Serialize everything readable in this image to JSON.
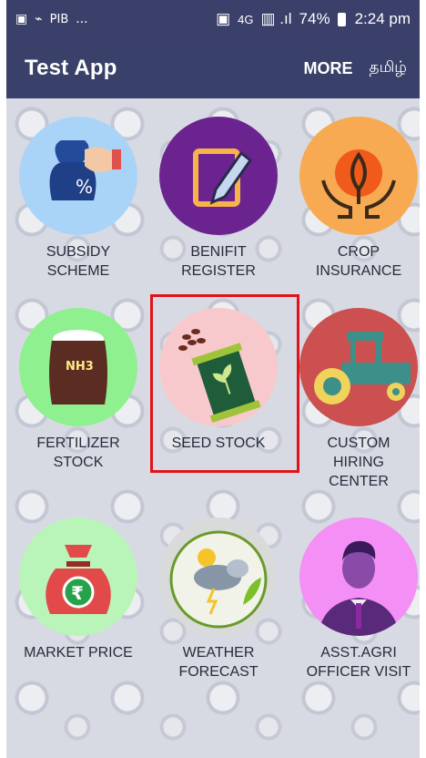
{
  "status_bar": {
    "left_icons": [
      "image-icon",
      "cast-icon"
    ],
    "pib_text": "PIB",
    "dots": "...",
    "network": "4G",
    "battery": "74%",
    "time": "2:24 pm"
  },
  "app_bar": {
    "title": "Test App",
    "more_label": "MORE",
    "language_label": "தமிழ்"
  },
  "tiles": [
    {
      "line1": "SUBSIDY",
      "line2": "SCHEME",
      "icon": "money-bag-hand-icon",
      "color": "#a9d4f8"
    },
    {
      "line1": "BENIFIT",
      "line2": "REGISTER",
      "icon": "pencil-document-icon",
      "color": "#6b2390"
    },
    {
      "line1": "CROP",
      "line2": "INSURANCE",
      "icon": "hands-plant-icon",
      "color": "#f8aa52"
    },
    {
      "line1": "FERTILIZER",
      "line2": "STOCK",
      "icon": "fertilizer-sack-icon",
      "color": "#8ff08f"
    },
    {
      "line1": "SEED STOCK",
      "line2": "",
      "icon": "seed-packet-icon",
      "color": "#f8c9cc"
    },
    {
      "line1": "CUSTOM",
      "line2": "HIRING",
      "line3": "CENTER",
      "icon": "tractor-icon",
      "color": "#cc5050"
    },
    {
      "line1": "MARKET PRICE",
      "line2": "",
      "icon": "rupee-bag-icon",
      "color": "#b9f5b8"
    },
    {
      "line1": "WEATHER",
      "line2": "FORECAST",
      "icon": "weather-icon",
      "color": "#d9dbdb"
    },
    {
      "line1": "ASST.AGRI",
      "line2": "OFFICER VISIT",
      "icon": "officer-icon",
      "color": "#f48ff5"
    }
  ],
  "sack_text": "NH3",
  "rupee_symbol": "₹",
  "highlight_color": "#e0121b"
}
